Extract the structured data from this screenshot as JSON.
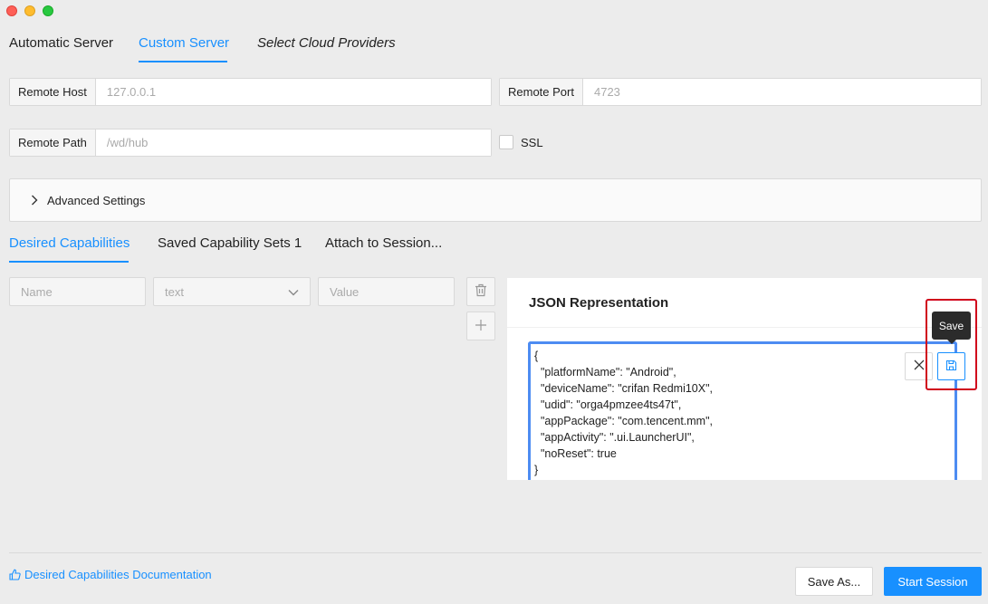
{
  "window": {
    "controls": [
      "close",
      "minimize",
      "zoom"
    ]
  },
  "server_tabs": [
    {
      "label": "Automatic Server",
      "active": false
    },
    {
      "label": "Custom Server",
      "active": true
    },
    {
      "label": "Select Cloud Providers",
      "active": false
    }
  ],
  "remote_host": {
    "label": "Remote Host",
    "placeholder": "127.0.0.1",
    "value": ""
  },
  "remote_port": {
    "label": "Remote Port",
    "placeholder": "4723",
    "value": ""
  },
  "remote_path": {
    "label": "Remote Path",
    "placeholder": "/wd/hub",
    "value": ""
  },
  "ssl": {
    "label": "SSL",
    "checked": false
  },
  "advanced_settings": {
    "label": "Advanced Settings",
    "expanded": false
  },
  "capability_tabs": [
    {
      "label": "Desired Capabilities",
      "active": true
    },
    {
      "label": "Saved Capability Sets 1",
      "active": false
    },
    {
      "label": "Attach to Session...",
      "active": false
    }
  ],
  "capability_row": {
    "name_placeholder": "Name",
    "type_value": "text",
    "value_placeholder": "Value"
  },
  "json_panel": {
    "title": "JSON Representation",
    "lines": [
      "{",
      "  \"platformName\": \"Android\",",
      "  \"deviceName\": \"crifan Redmi10X\",",
      "  \"udid\": \"orga4pmzee4ts47t\",",
      "  \"appPackage\": \"com.tencent.mm\",",
      "  \"appActivity\": \".ui.LauncherUI\",",
      "  \"noReset\": true",
      "}"
    ],
    "tooltip": "Save"
  },
  "footer": {
    "doc_link": "Desired Capabilities Documentation",
    "save_as": "Save As...",
    "start_session": "Start Session"
  },
  "colors": {
    "accent": "#1890ff",
    "highlight": "#d0021b",
    "json_border": "#4d8cf2"
  },
  "icons": {
    "advanced_toggle": "chevron-right-icon",
    "type_dropdown": "chevron-down-icon",
    "delete_capability": "trash-icon",
    "add_capability": "plus-icon",
    "cancel_edit": "close-icon",
    "save_json": "save-icon",
    "doc_link": "thumbs-up-icon"
  }
}
